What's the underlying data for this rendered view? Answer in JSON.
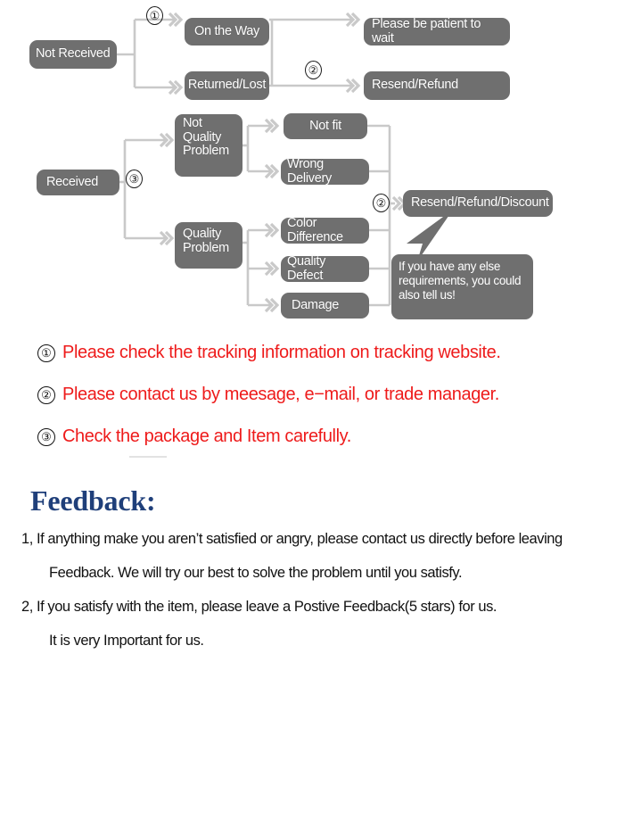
{
  "diagram": {
    "nodes": {
      "not_received": "Not Received",
      "on_the_way": "On the Way",
      "returned_lost": "Returned/Lost",
      "please_wait": "Please be patient to wait",
      "resend_refund": "Resend/Refund",
      "received": "Received",
      "not_quality_problem_l1": "Not",
      "not_quality_problem_l2": "Quality",
      "not_quality_problem_l3": "Problem",
      "quality_problem_l1": "Quality",
      "quality_problem_l2": "Problem",
      "not_fit": "Not fit",
      "wrong_delivery": "Wrong Delivery",
      "color_difference": "Color Difference",
      "quality_defect": "Quality Defect",
      "damage": "Damage",
      "resend_refund_discount": "Resend/Refund/Discount"
    },
    "markers": {
      "one": "①",
      "two_top": "②",
      "three": "③",
      "two_right": "②"
    },
    "bubble": {
      "line1": "If you have any else",
      "line2": "requirements, you could",
      "line3": "also tell us!"
    },
    "colors": {
      "node_fill": "#6f6f6f",
      "node_text": "#ffffff",
      "connector": "#c9c9c9"
    }
  },
  "instructions": [
    {
      "num": "①",
      "text": "Please check the tracking information on tracking website."
    },
    {
      "num": "②",
      "text": "Please contact us by meesage, e−mail, or trade manager."
    },
    {
      "num": "③",
      "text": "Check the package and Item carefully."
    }
  ],
  "instructions_color": "#ee1b1b",
  "feedback": {
    "title": "Feedback:",
    "title_color": "#1f3f7a",
    "lines": [
      "1, If anything make you aren’t satisfied or angry, please contact us directly before leaving",
      "Feedback. We will try our best to solve the problem until you satisfy.",
      "2, If you satisfy with the item, please leave a Postive Feedback(5 stars) for us.",
      "It is very Important for us."
    ]
  }
}
